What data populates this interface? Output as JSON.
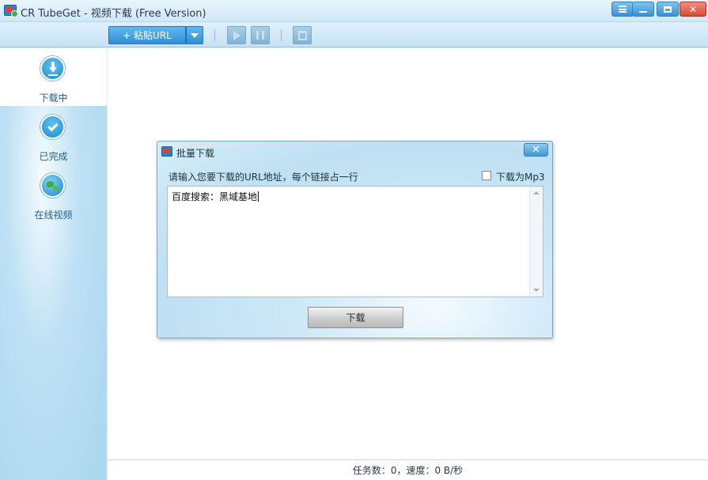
{
  "window": {
    "title": "CR TubeGet - 视频下载 (Free Version)"
  },
  "toolbar": {
    "paste_url_label": "+ 粘贴URL"
  },
  "sidebar": {
    "items": [
      {
        "label": "下载中",
        "icon": "download-icon",
        "active": true
      },
      {
        "label": "已完成",
        "icon": "checkmark-icon",
        "active": false
      },
      {
        "label": "在线视频",
        "icon": "globe-icon",
        "active": false
      }
    ]
  },
  "dialog": {
    "title": "批量下载",
    "prompt": "请输入您要下载的URL地址，每个链接占一行",
    "mp3_label": "下载为Mp3",
    "mp3_checked": false,
    "url_value": "百度搜索：黑域基地",
    "download_button": "下载"
  },
  "status": {
    "text": "任务数：0，速度：0 B/秒"
  },
  "colors": {
    "accent": "#2f8fd5",
    "sidebar_bg": "#bfe1f4",
    "close_red": "#d84a37"
  }
}
